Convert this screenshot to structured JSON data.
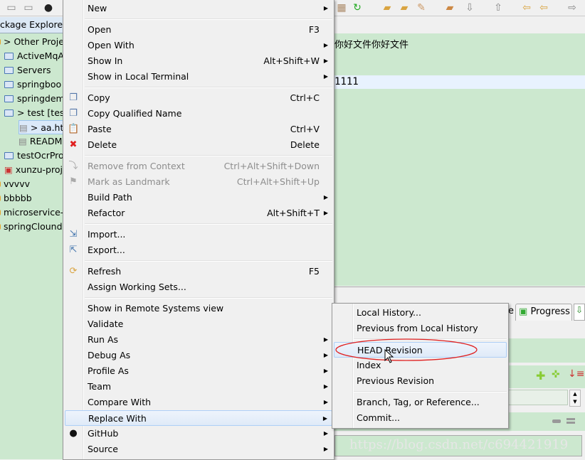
{
  "explorer": {
    "tab_label": "ckage Explorer",
    "items": [
      {
        "label": "> Other Proje",
        "type": "working-set"
      },
      {
        "label": "ActiveMqA",
        "type": "project"
      },
      {
        "label": "Servers",
        "type": "project"
      },
      {
        "label": "springboo",
        "type": "project"
      },
      {
        "label": "springdem",
        "type": "project"
      },
      {
        "label": "> test [tes",
        "type": "project-open"
      },
      {
        "label": "> aa.ht",
        "type": "file",
        "selected": true
      },
      {
        "label": "READM",
        "type": "file"
      },
      {
        "label": "testOcrPro",
        "type": "project"
      },
      {
        "label": "xunzu-proj",
        "type": "maven-project"
      },
      {
        "label": "vvvvv",
        "type": "working-set"
      },
      {
        "label": "bbbbb",
        "type": "working-set"
      },
      {
        "label": "microservice-",
        "type": "working-set"
      },
      {
        "label": "springClound",
        "type": "working-set"
      }
    ]
  },
  "editor": {
    "line1": "你好文件你好文件",
    "line2": "1111"
  },
  "bottom": {
    "tab_fragment": "e",
    "progress_tab": "Progress",
    "watermark": "https://blog.csdn.net/c694421919"
  },
  "context_menu": {
    "items": [
      {
        "label": "New",
        "arrow": true
      },
      {
        "sep": true
      },
      {
        "label": "Open",
        "shortcut": "F3"
      },
      {
        "label": "Open With",
        "arrow": true
      },
      {
        "label": "Show In",
        "shortcut": "Alt+Shift+W",
        "arrow": true
      },
      {
        "label": "Show in Local Terminal",
        "arrow": true
      },
      {
        "sep": true
      },
      {
        "label": "Copy",
        "shortcut": "Ctrl+C",
        "icon": "copy-icon"
      },
      {
        "label": "Copy Qualified Name",
        "icon": "copy-qualified-icon"
      },
      {
        "label": "Paste",
        "shortcut": "Ctrl+V",
        "icon": "paste-icon"
      },
      {
        "label": "Delete",
        "shortcut": "Delete",
        "icon": "delete-icon"
      },
      {
        "sep": true
      },
      {
        "label": "Remove from Context",
        "shortcut": "Ctrl+Alt+Shift+Down",
        "disabled": true,
        "icon": "remove-context-icon"
      },
      {
        "label": "Mark as Landmark",
        "shortcut": "Ctrl+Alt+Shift+Up",
        "disabled": true,
        "icon": "landmark-icon"
      },
      {
        "label": "Build Path",
        "arrow": true
      },
      {
        "label": "Refactor",
        "shortcut": "Alt+Shift+T",
        "arrow": true
      },
      {
        "sep": true
      },
      {
        "label": "Import...",
        "icon": "import-icon"
      },
      {
        "label": "Export...",
        "icon": "export-icon"
      },
      {
        "sep": true
      },
      {
        "label": "Refresh",
        "shortcut": "F5",
        "icon": "refresh-icon"
      },
      {
        "label": "Assign Working Sets..."
      },
      {
        "sep": true
      },
      {
        "label": "Show in Remote Systems view"
      },
      {
        "label": "Validate"
      },
      {
        "label": "Run As",
        "arrow": true
      },
      {
        "label": "Debug As",
        "arrow": true
      },
      {
        "label": "Profile As",
        "arrow": true
      },
      {
        "label": "Team",
        "arrow": true
      },
      {
        "label": "Compare With",
        "arrow": true
      },
      {
        "label": "Replace With",
        "arrow": true,
        "selected": true
      },
      {
        "label": "GitHub",
        "arrow": true,
        "icon": "github-icon"
      },
      {
        "label": "Source",
        "arrow": true
      }
    ]
  },
  "submenu": {
    "items": [
      {
        "label": "Local History..."
      },
      {
        "label": "Previous from Local History"
      },
      {
        "sep": true
      },
      {
        "label": "HEAD Revision",
        "selected": true
      },
      {
        "label": "Index"
      },
      {
        "label": "Previous Revision"
      },
      {
        "sep": true
      },
      {
        "label": "Branch, Tag, or Reference..."
      },
      {
        "label": "Commit..."
      }
    ]
  },
  "colors": {
    "editor_bg": "#cce8cf",
    "menu_bg": "#f0f0f0",
    "highlight_ellipse": "#e02020"
  }
}
